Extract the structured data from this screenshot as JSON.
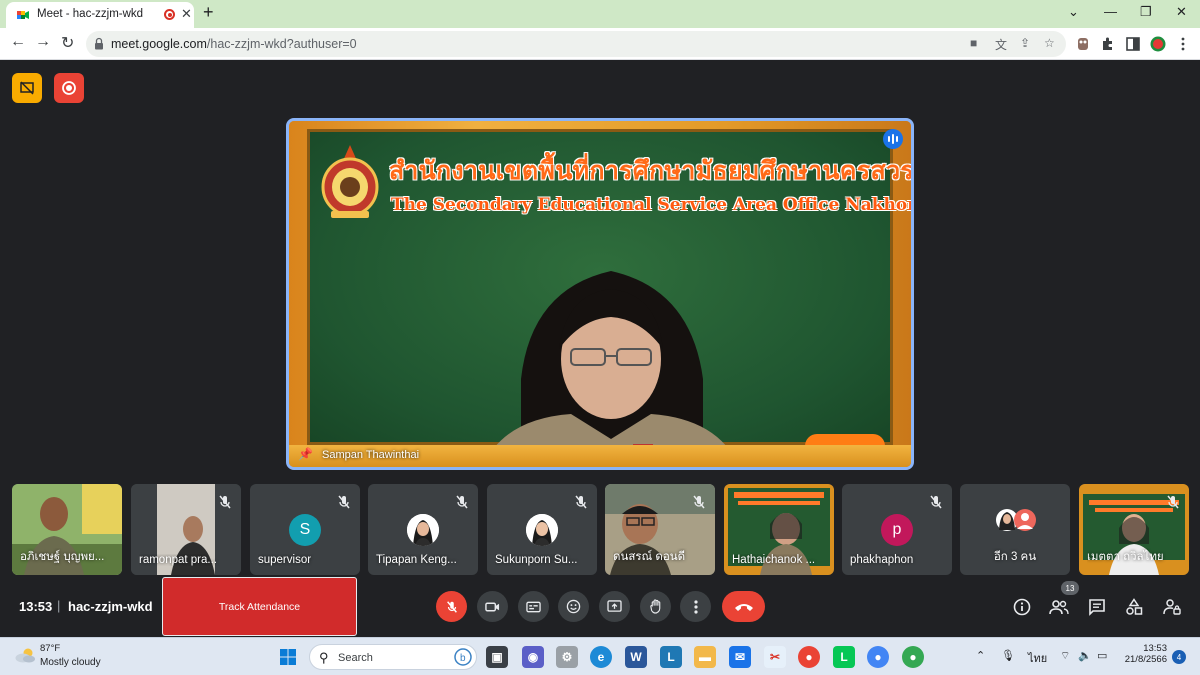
{
  "browser": {
    "tab_title": "Meet - hac-zzjm-wkd",
    "tab_close_glyph": "✕",
    "new_tab_glyph": "+",
    "window_controls": [
      "⌄",
      "—",
      "❐",
      "✕"
    ],
    "url_host": "meet.google.com",
    "url_path": "/hac-zzjm-wkd?authuser=0",
    "nav": {
      "back": "←",
      "forward": "→",
      "reload": "↻"
    },
    "accent": "#cfe8c6"
  },
  "meeting": {
    "code": "hac-zzjm-wkd",
    "time": "13:53",
    "separator": "|",
    "track_attendance_label": "Track Attendance",
    "people_count": "13",
    "main_speaker": {
      "name": "Sampan Thawinthai",
      "banner_thai": "สำนักงานเขตพื้นที่การศึกษามัธยมศึกษานครสวรรค์",
      "banner_english": "The Secondary Educational Service Area Office Nakhon Sawan"
    },
    "participants": [
      {
        "name": "อภิเชษฐ์ บุญพย...",
        "type": "video",
        "muted": false
      },
      {
        "name": "ramonpat pra...",
        "type": "video",
        "muted": true
      },
      {
        "name": "supervisor",
        "type": "initial",
        "initial": "S",
        "color": "#129eaf",
        "muted": true
      },
      {
        "name": "Tipapan Keng...",
        "type": "photo",
        "muted": true
      },
      {
        "name": "Sukunporn Su...",
        "type": "photo",
        "muted": true
      },
      {
        "name": "ดนสรณ์ ดอนดี",
        "type": "video",
        "muted": true
      },
      {
        "name": "Hathaichanok ...",
        "type": "video",
        "muted": false
      },
      {
        "name": "phakhaphon",
        "type": "initial",
        "initial": "p",
        "color": "#c2185b",
        "muted": true
      },
      {
        "name": "อีก 3 คน",
        "type": "group",
        "muted": false
      },
      {
        "name": "เมตตา ถวิลไทย",
        "type": "video",
        "muted": true
      }
    ]
  },
  "taskbar": {
    "temperature": "87°F",
    "weather": "Mostly cloudy",
    "search_placeholder": "Search",
    "language": "ไทย",
    "clock_time": "13:53",
    "clock_date": "21/8/2566",
    "notification_count": "4"
  }
}
